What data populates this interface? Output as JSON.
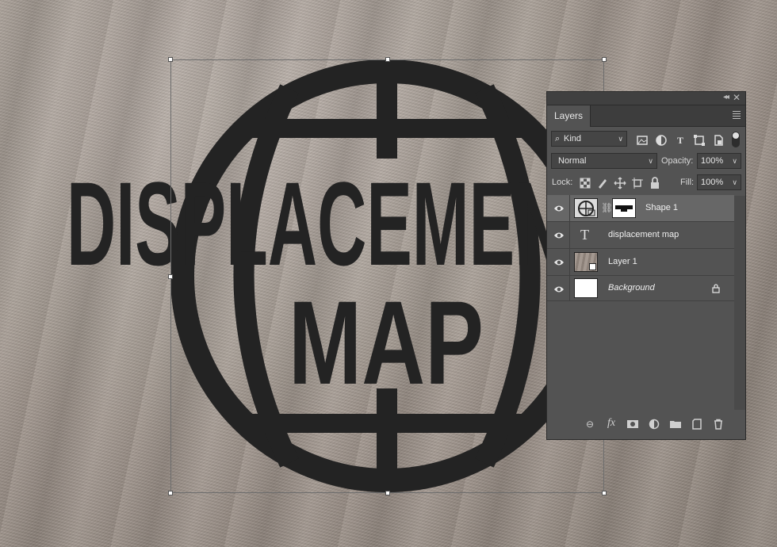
{
  "artwork": {
    "word1": "DISPLACEMENT",
    "word2": "MAP",
    "ink_color": "#232323"
  },
  "layers_panel": {
    "tab_label": "Layers",
    "filter": {
      "value": "Kind",
      "search_icon": "search-icon"
    },
    "blend_mode": "Normal",
    "opacity_label": "Opacity:",
    "opacity_value": "100%",
    "lock_label": "Lock:",
    "fill_label": "Fill:",
    "fill_value": "100%",
    "layers": [
      {
        "name": "Shape 1",
        "kind": "shape",
        "selected": true
      },
      {
        "name": "displacement map",
        "kind": "text",
        "selected": false
      },
      {
        "name": "Layer 1",
        "kind": "smart-object",
        "selected": false
      },
      {
        "name": "Background",
        "kind": "background",
        "selected": false,
        "locked": true
      }
    ],
    "footer_icons": [
      "link-icon",
      "fx-icon",
      "mask-icon",
      "adjustment-icon",
      "folder-icon",
      "new-layer-icon",
      "trash-icon"
    ],
    "fx_label": "fx"
  }
}
